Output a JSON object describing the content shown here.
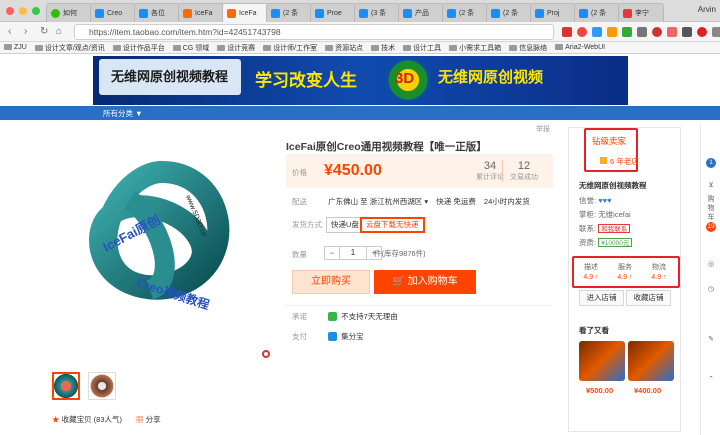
{
  "browser": {
    "tabs": [
      "如何",
      "Creo",
      "各位",
      "IceFa",
      "IceFa",
      "(2 条",
      "Proe",
      "(3 条",
      "产品",
      "(2 条",
      "(2 条",
      "Proj",
      "(2 条",
      "李宁"
    ],
    "user": "Arvin",
    "url": "https://item.taobao.com/item.htm?id=42451743798",
    "bookmarks": [
      "ZJU",
      "设计文章/观点/资讯",
      "设计作品平台",
      "CG 领域",
      "设计竞赛",
      "设计师/工作室",
      "资源站点",
      "技术",
      "设计工具",
      "小需求工具箱",
      "信息脉络",
      "Aria2-WebUI"
    ]
  },
  "banner": {
    "name": "无维网原创视频教程",
    "slogan": "学习改变人生",
    "subtitle": "无维网原创视频",
    "logo_text": "3D"
  },
  "nav": {
    "all_categories": "所有分类 ▼"
  },
  "report": "举报",
  "gallery": {
    "knot_text_1": "IceFai原创",
    "knot_text_2": "Creo视频教程",
    "knot_text_3": "www.5D3D.cn"
  },
  "collect": {
    "favorite": "收藏宝贝 (83人气)",
    "share": "分享"
  },
  "product": {
    "title": "IceFai原创Creo通用视频教程【唯一正版】",
    "price_label": "价格",
    "price": "¥450.00",
    "reviews_count": "34",
    "reviews_label": "累计评论",
    "deals_count": "12",
    "deals_label": "交易成功",
    "ship_label": "配送",
    "ship_from": "广东佛山 至",
    "ship_to": "浙江杭州西湖区 ▾",
    "ship_method": "快递 免运费",
    "ship_time": "24小时内发货",
    "delivery_label": "发货方式",
    "delivery_options": [
      "快递U盘",
      "云盘下载无快递"
    ],
    "qty_label": "数量",
    "qty": "1",
    "qty_minus": "−",
    "qty_plus": "+",
    "stock": "件(库存9876件)",
    "buy_now": "立即购买",
    "add_cart": "加入购物车",
    "promise_label": "承诺",
    "promise": "不支持7天无理由",
    "pay_label": "支付",
    "pay": "集分宝"
  },
  "shop": {
    "level": "钻级卖家",
    "age": "6 年老店",
    "name": "无维网原创视频教程",
    "credit_label": "信誉:",
    "credit_hearts": "♥♥♥",
    "seller_label": "掌柜:",
    "seller": "无维icefai",
    "contact_label": "联系:",
    "contact_badge": "和我联系",
    "deposit_label": "资质:",
    "deposit_badge": "¥10000元",
    "scores": [
      {
        "label": "描述",
        "value": "4.9 ↑"
      },
      {
        "label": "服务",
        "value": "4.9 ↑"
      },
      {
        "label": "物流",
        "value": "4.9 ↑"
      }
    ],
    "enter_shop": "进入店铺",
    "follow_shop": "收藏店铺",
    "also_title": "看了又看",
    "also_prices": [
      "¥500.00",
      "¥400.00"
    ]
  },
  "sidebar": {
    "cart": "购物车",
    "cart_count": "19",
    "top_count": "1"
  },
  "colors": {
    "accent": "#ff4400",
    "nav_blue": "#2a6fc6",
    "annotation_red": "#e8202a"
  }
}
